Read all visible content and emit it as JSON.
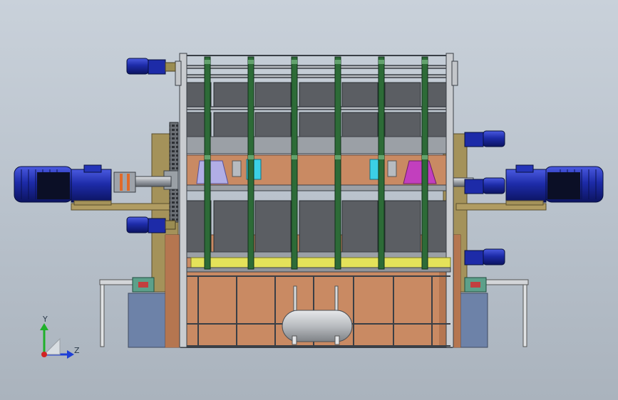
{
  "triad": {
    "y_label": "Y",
    "z_label": "Z"
  },
  "colors": {
    "background": "#c0c8d1",
    "frame": "#4a4f57",
    "plate_dark": "#5b5e63",
    "copper": "#c98a63",
    "motor_blue": "#1d2ba8",
    "olive": "#a4925a",
    "green_ring": "#2d6b37",
    "cyan_part": "#3bd0e6",
    "magenta_part": "#c23fbe",
    "lavender_part": "#b1aee6",
    "yellow_strip": "#e4e25a",
    "steel_base": "#6d82a8",
    "tank": "#b9bcc0"
  }
}
